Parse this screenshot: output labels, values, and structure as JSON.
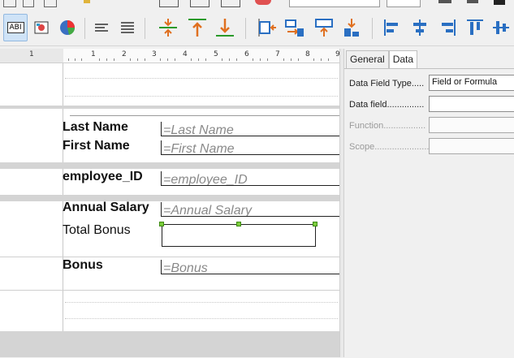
{
  "toolbar": {
    "items": [
      {
        "icon": "text-label-icon",
        "label": "ABI",
        "active": true
      },
      {
        "icon": "image-control-icon"
      },
      {
        "icon": "chart-icon"
      },
      {
        "icon": "align-left-lines-icon"
      },
      {
        "icon": "align-justify-lines-icon"
      },
      {
        "icon": "center-vertical-icon"
      },
      {
        "icon": "align-top-icon"
      },
      {
        "icon": "align-bottom-icon"
      },
      {
        "icon": "align-left-objects-icon"
      },
      {
        "icon": "align-right-objects-icon"
      },
      {
        "icon": "align-top-objects-icon"
      },
      {
        "icon": "align-bottom-objects-icon"
      },
      {
        "icon": "align-left-icon"
      },
      {
        "icon": "align-center-icon"
      },
      {
        "icon": "align-right-icon"
      },
      {
        "icon": "align-top-edges-icon"
      },
      {
        "icon": "align-middle-icon"
      }
    ]
  },
  "ruler": {
    "numbers": [
      "1",
      "1",
      "2",
      "3",
      "4",
      "5",
      "6",
      "7",
      "8",
      "9"
    ]
  },
  "report": {
    "fields": [
      {
        "label": "Last Name",
        "value": "=Last Name"
      },
      {
        "label": "First Name",
        "value": "=First Name"
      },
      {
        "label": "employee_ID",
        "value": "=employee_ID"
      },
      {
        "label": "Annual Salary",
        "value": "=Annual Salary"
      },
      {
        "label": "Total Bonus",
        "value": ""
      },
      {
        "label": "Bonus",
        "value": "=Bonus"
      }
    ]
  },
  "panel": {
    "tabs": [
      "General",
      "Data"
    ],
    "selected_tab": "Data",
    "rows": [
      {
        "label": "Data Field Type.....",
        "value": "Field or Formula",
        "enabled": true
      },
      {
        "label": "Data field...............",
        "value": "",
        "enabled": true
      },
      {
        "label": "Function.................",
        "value": "",
        "enabled": false
      },
      {
        "label": "Scope......................",
        "value": "",
        "enabled": false
      }
    ]
  },
  "colors": {
    "accent": "#93b9e0",
    "handle": "#7ccd3c"
  }
}
